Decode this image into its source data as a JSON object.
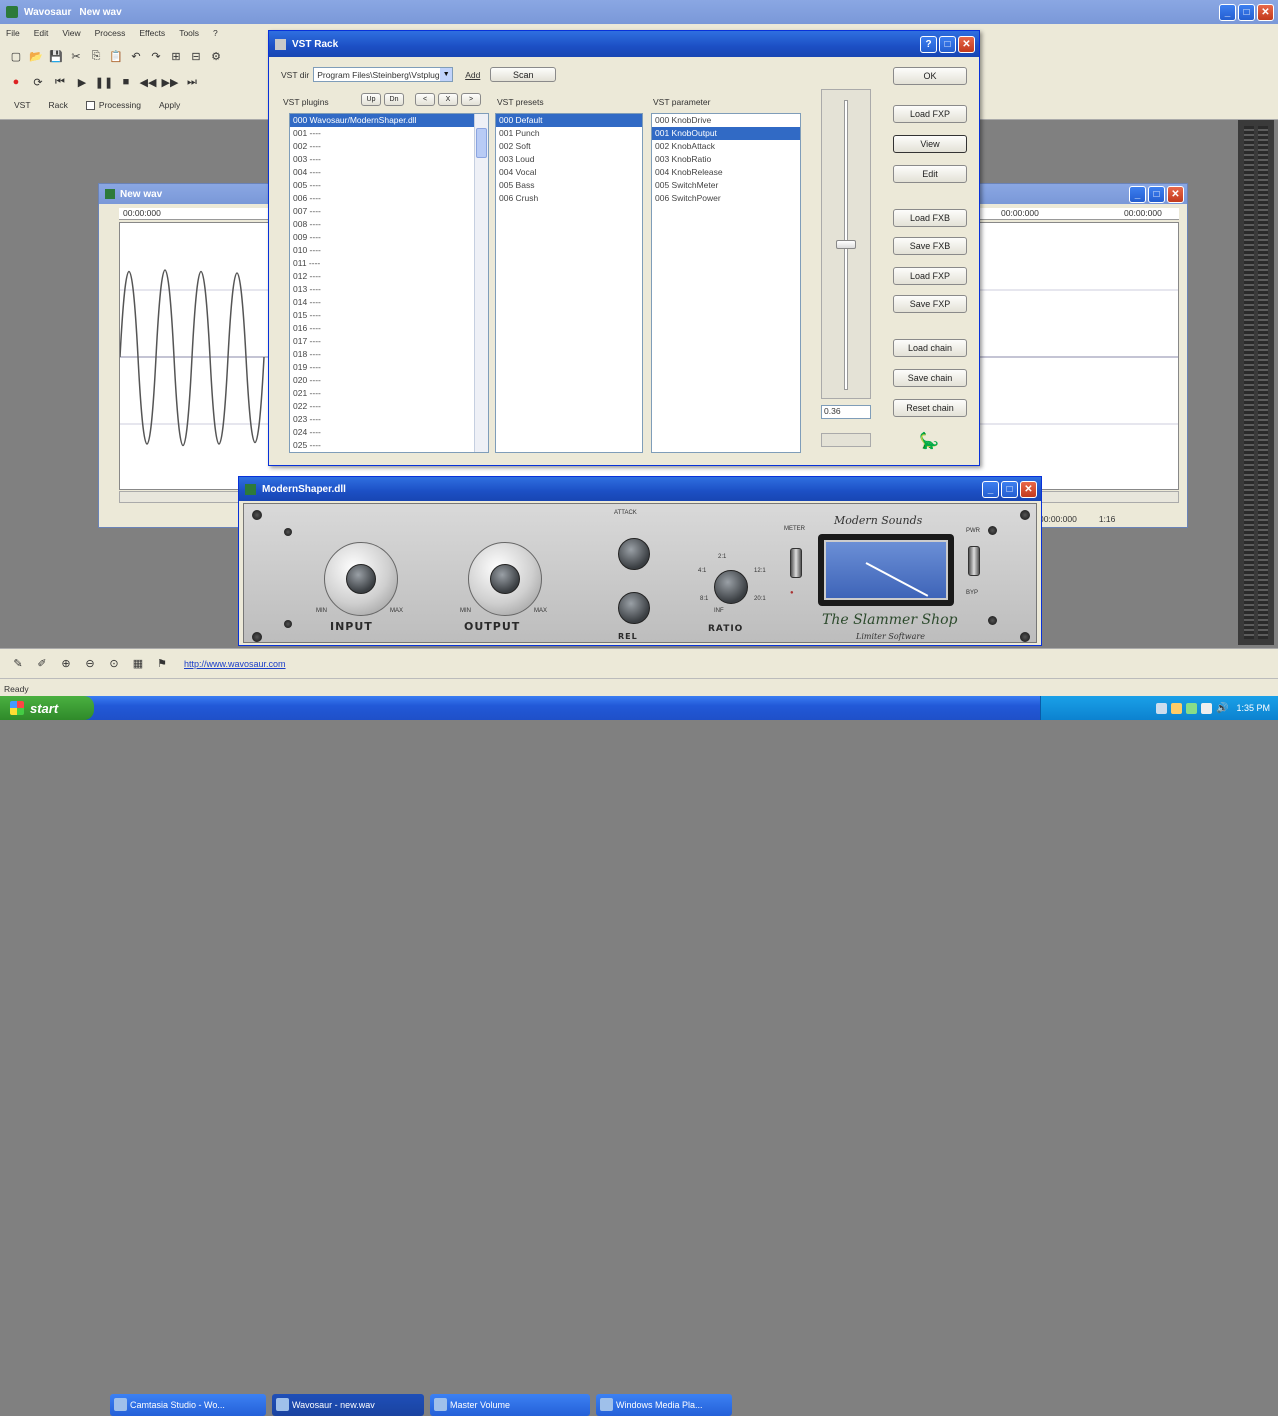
{
  "main_window": {
    "title": "Wavosaur",
    "document_name": "New wav",
    "menu": [
      "File",
      "Edit",
      "View",
      "Process",
      "Effects",
      "Tools",
      "?"
    ],
    "toolbar2": [
      "VST",
      "Rack",
      "Processing",
      "Apply"
    ],
    "status": "Ready",
    "link": "http://www.wavosaur.com"
  },
  "wave_window": {
    "title": "New wav",
    "ruler_left": "00:00:000",
    "ruler_right": "00:00:000",
    "ruler_right2": "00:00:000",
    "status_time": "00:00:000",
    "status_zoom": "1:16"
  },
  "vst_rack": {
    "title": "VST Rack",
    "vst_dir_label": "VST dir",
    "vst_dir_value": "Program Files\\Steinberg\\Vstplugins",
    "add_label": "Add",
    "scan_label": "Scan",
    "ok_label": "OK",
    "plugins_label": "VST plugins",
    "presets_label": "VST presets",
    "params_label": "VST parameter",
    "nav_buttons": [
      "Up",
      "Dn",
      "<",
      "X",
      ">"
    ],
    "plugins": [
      "000 Wavosaur/ModernShaper.dll",
      "001 ----",
      "002 ----",
      "003 ----",
      "004 ----",
      "005 ----",
      "006 ----",
      "007 ----",
      "008 ----",
      "009 ----",
      "010 ----",
      "011 ----",
      "012 ----",
      "013 ----",
      "014 ----",
      "015 ----",
      "016 ----",
      "017 ----",
      "018 ----",
      "019 ----",
      "020 ----",
      "021 ----",
      "022 ----",
      "023 ----",
      "024 ----",
      "025 ----"
    ],
    "presets": [
      "000 Default",
      "001 Punch",
      "002 Soft",
      "003 Loud",
      "004 Vocal",
      "005 Bass",
      "006 Crush"
    ],
    "params": [
      "000 KnobDrive",
      "001 KnobOutput",
      "002 KnobAttack",
      "003 KnobRatio",
      "004 KnobRelease",
      "005 SwitchMeter",
      "006 SwitchPower"
    ],
    "slider_value": "0.36",
    "buttons": [
      "Load FXP",
      "View",
      "Edit",
      "Load FXB",
      "Save FXB",
      "Load FXP",
      "Save FXP",
      "Load chain",
      "Save chain",
      "Reset chain"
    ]
  },
  "plugin_window": {
    "title": "ModernShaper.dll",
    "brand": "Modern Sounds",
    "product": "The Slammer Shop",
    "subtitle": "Limiter Software",
    "input_label": "INPUT",
    "output_label": "OUTPUT",
    "input_scale": [
      "MIN",
      "MAX"
    ],
    "attack_label": "ATTACK",
    "release_label": "REL",
    "ratio_label": "RATIO",
    "ratio_ticks": [
      "2:1",
      "4:1",
      "8:1",
      "12:1",
      "20:1",
      "INF"
    ],
    "switch_top": "METER",
    "power_label": "PWR",
    "bypass_label": "BYP"
  },
  "taskbar": {
    "start_label": "start",
    "tasks": [
      "Camtasia Studio - Wo...",
      "Wavosaur - new.wav",
      "Master Volume",
      "Windows Media Pla..."
    ],
    "clock": "1:35 PM"
  }
}
